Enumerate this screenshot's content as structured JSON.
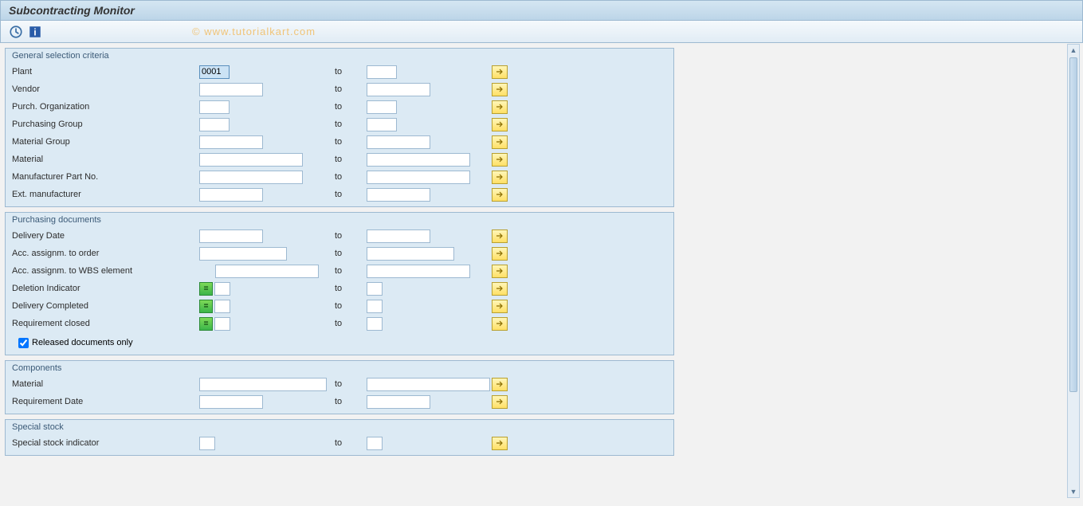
{
  "title": "Subcontracting Monitor",
  "watermark": "© www.tutorialkart.com",
  "to_label": "to",
  "groups": {
    "general": {
      "title": "General selection criteria",
      "rows": {
        "plant": {
          "label": "Plant",
          "from": "0001",
          "to": ""
        },
        "vendor": {
          "label": "Vendor",
          "from": "",
          "to": ""
        },
        "purch_org": {
          "label": "Purch. Organization",
          "from": "",
          "to": ""
        },
        "purch_group": {
          "label": "Purchasing Group",
          "from": "",
          "to": ""
        },
        "mat_group": {
          "label": "Material Group",
          "from": "",
          "to": ""
        },
        "material": {
          "label": "Material",
          "from": "",
          "to": ""
        },
        "mfr_part": {
          "label": "Manufacturer Part No.",
          "from": "",
          "to": ""
        },
        "ext_mfr": {
          "label": "Ext. manufacturer",
          "from": "",
          "to": ""
        }
      }
    },
    "purchasing": {
      "title": "Purchasing documents",
      "rows": {
        "delivery_date": {
          "label": "Delivery Date",
          "from": "",
          "to": ""
        },
        "acc_order": {
          "label": "Acc. assignm. to order",
          "from": "",
          "to": ""
        },
        "acc_wbs": {
          "label": "Acc. assignm. to WBS element",
          "from": "",
          "to": ""
        },
        "deletion": {
          "label": "Deletion Indicator",
          "from": "",
          "to": ""
        },
        "delivery_completed": {
          "label": "Delivery Completed",
          "from": "",
          "to": ""
        },
        "req_closed": {
          "label": "Requirement closed",
          "from": "",
          "to": ""
        }
      },
      "released_checkbox": "Released documents only",
      "released_checked": true
    },
    "components": {
      "title": "Components",
      "rows": {
        "material": {
          "label": "Material",
          "from": "",
          "to": ""
        },
        "req_date": {
          "label": "Requirement Date",
          "from": "",
          "to": ""
        }
      }
    },
    "special": {
      "title": "Special stock",
      "rows": {
        "indicator": {
          "label": "Special stock indicator",
          "from": "",
          "to": ""
        }
      }
    }
  }
}
